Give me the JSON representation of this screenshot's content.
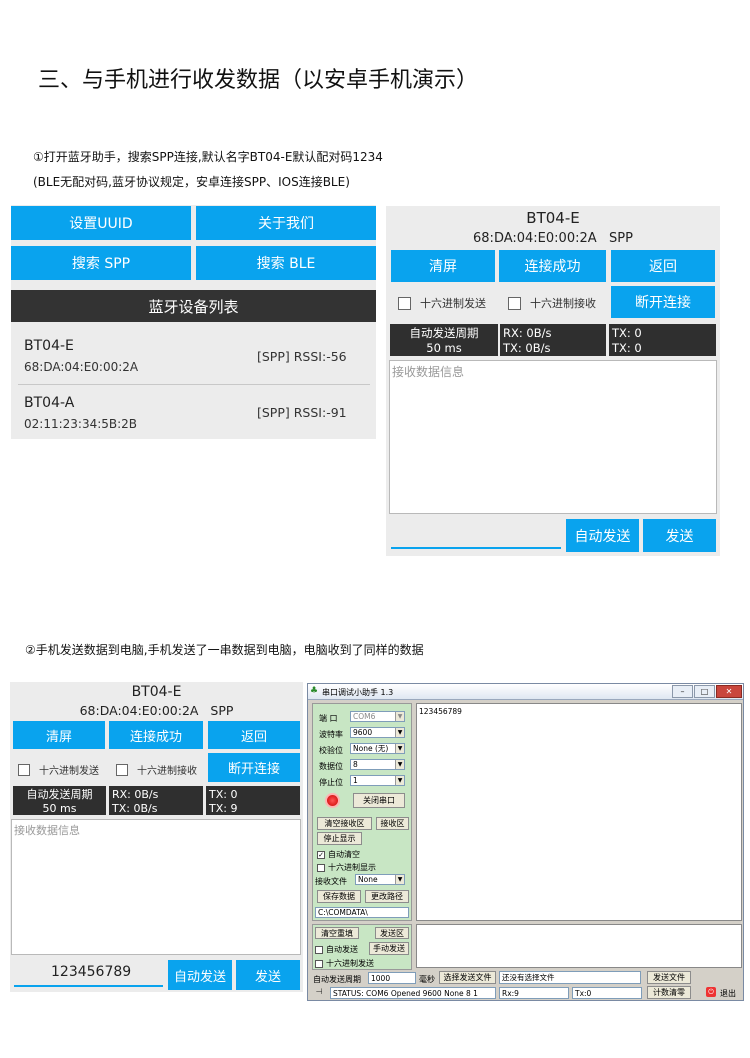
{
  "heading": "三、与手机进行收发数据（以安卓手机演示）",
  "step1": {
    "line1": "①打开蓝牙助手，搜索SPP连接,默认名字BT04-E默认配对码1234",
    "line2": "(BLE无配对码,蓝牙协议规定，安卓连接SPP、IOS连接BLE)"
  },
  "step2": {
    "line1": "②手机发送数据到电脑,手机发送了一串数据到电脑，电脑收到了同样的数据"
  },
  "device_list": {
    "buttons": [
      "设置UUID",
      "关于我们",
      "搜索 SPP",
      "搜索 BLE"
    ],
    "title": "蓝牙设备列表",
    "devices": [
      {
        "name": "BT04-E",
        "mac": "68:DA:04:E0:00:2A",
        "info": "[SPP]  RSSI:-56"
      },
      {
        "name": "BT04-A",
        "mac": "02:11:23:34:5B:2B",
        "info": "[SPP]  RSSI:-91"
      }
    ]
  },
  "app1": {
    "name": "BT04-E",
    "mac": "68:DA:04:E0:00:2A   SPP",
    "clear": "清屏",
    "connected": "连接成功",
    "back": "返回",
    "hex_send": "十六进制发送",
    "hex_recv": "十六进制接收",
    "disconnect": "断开连接",
    "period_label": "自动发送周期",
    "period_value": "50 ms",
    "rx_line1": "RX: 0B/s",
    "rx_line2": "TX: 0B/s",
    "tx_line1": "TX: 0",
    "tx_line2": "TX: 0",
    "recv_placeholder": "接收数据信息",
    "send_input": "",
    "auto_send": "自动发送",
    "send": "发送"
  },
  "app2": {
    "name": "BT04-E",
    "mac": "68:DA:04:E0:00:2A   SPP",
    "clear": "清屏",
    "connected": "连接成功",
    "back": "返回",
    "hex_send": "十六进制发送",
    "hex_recv": "十六进制接收",
    "disconnect": "断开连接",
    "period_label": "自动发送周期",
    "period_value": "50 ms",
    "rx_line1": "RX: 0B/s",
    "rx_line2": "TX: 0B/s",
    "tx_line1": "TX: 0",
    "tx_line2": "TX: 9",
    "recv_placeholder": "接收数据信息",
    "send_input": "123456789",
    "auto_send": "自动发送",
    "send": "发送"
  },
  "serial": {
    "title": "串口调试小助手 1.3",
    "port_label": "端  口",
    "port_value": "COM6",
    "baud_label": "波特率",
    "baud_value": "9600",
    "parity_label": "校验位",
    "parity_value": "None (无)",
    "databits_label": "数据位",
    "databits_value": "8",
    "stopbits_label": "停止位",
    "stopbits_value": "1",
    "close_port": "关闭串口",
    "clear_recv": "清空接收区",
    "recv_area": "接收区",
    "stop_display": "停止显示",
    "auto_clear": "自动清空",
    "hex_display": "十六进制显示",
    "recv_file_label": "接收文件",
    "recv_file_value": "None",
    "save_data": "保存数据",
    "change_path": "更改路径",
    "path": "C:\\COMDATA\\",
    "received": "123456789",
    "clear_resend": "清空重填",
    "send_area": "发送区",
    "auto_send": "自动发送",
    "manual_send": "手动发送",
    "hex_send": "十六进制发送",
    "period_label": "自动发送周期",
    "period_value": "1000",
    "ms": "毫秒",
    "choose_file": "选择发送文件",
    "no_file": "还没有选择文件",
    "send_file": "发送文件",
    "status": "STATUS: COM6 Opened 9600 None  8 1",
    "rx": "Rx:9",
    "tx": "Tx:0",
    "count_clear": "计数清零",
    "exit": "退出"
  }
}
